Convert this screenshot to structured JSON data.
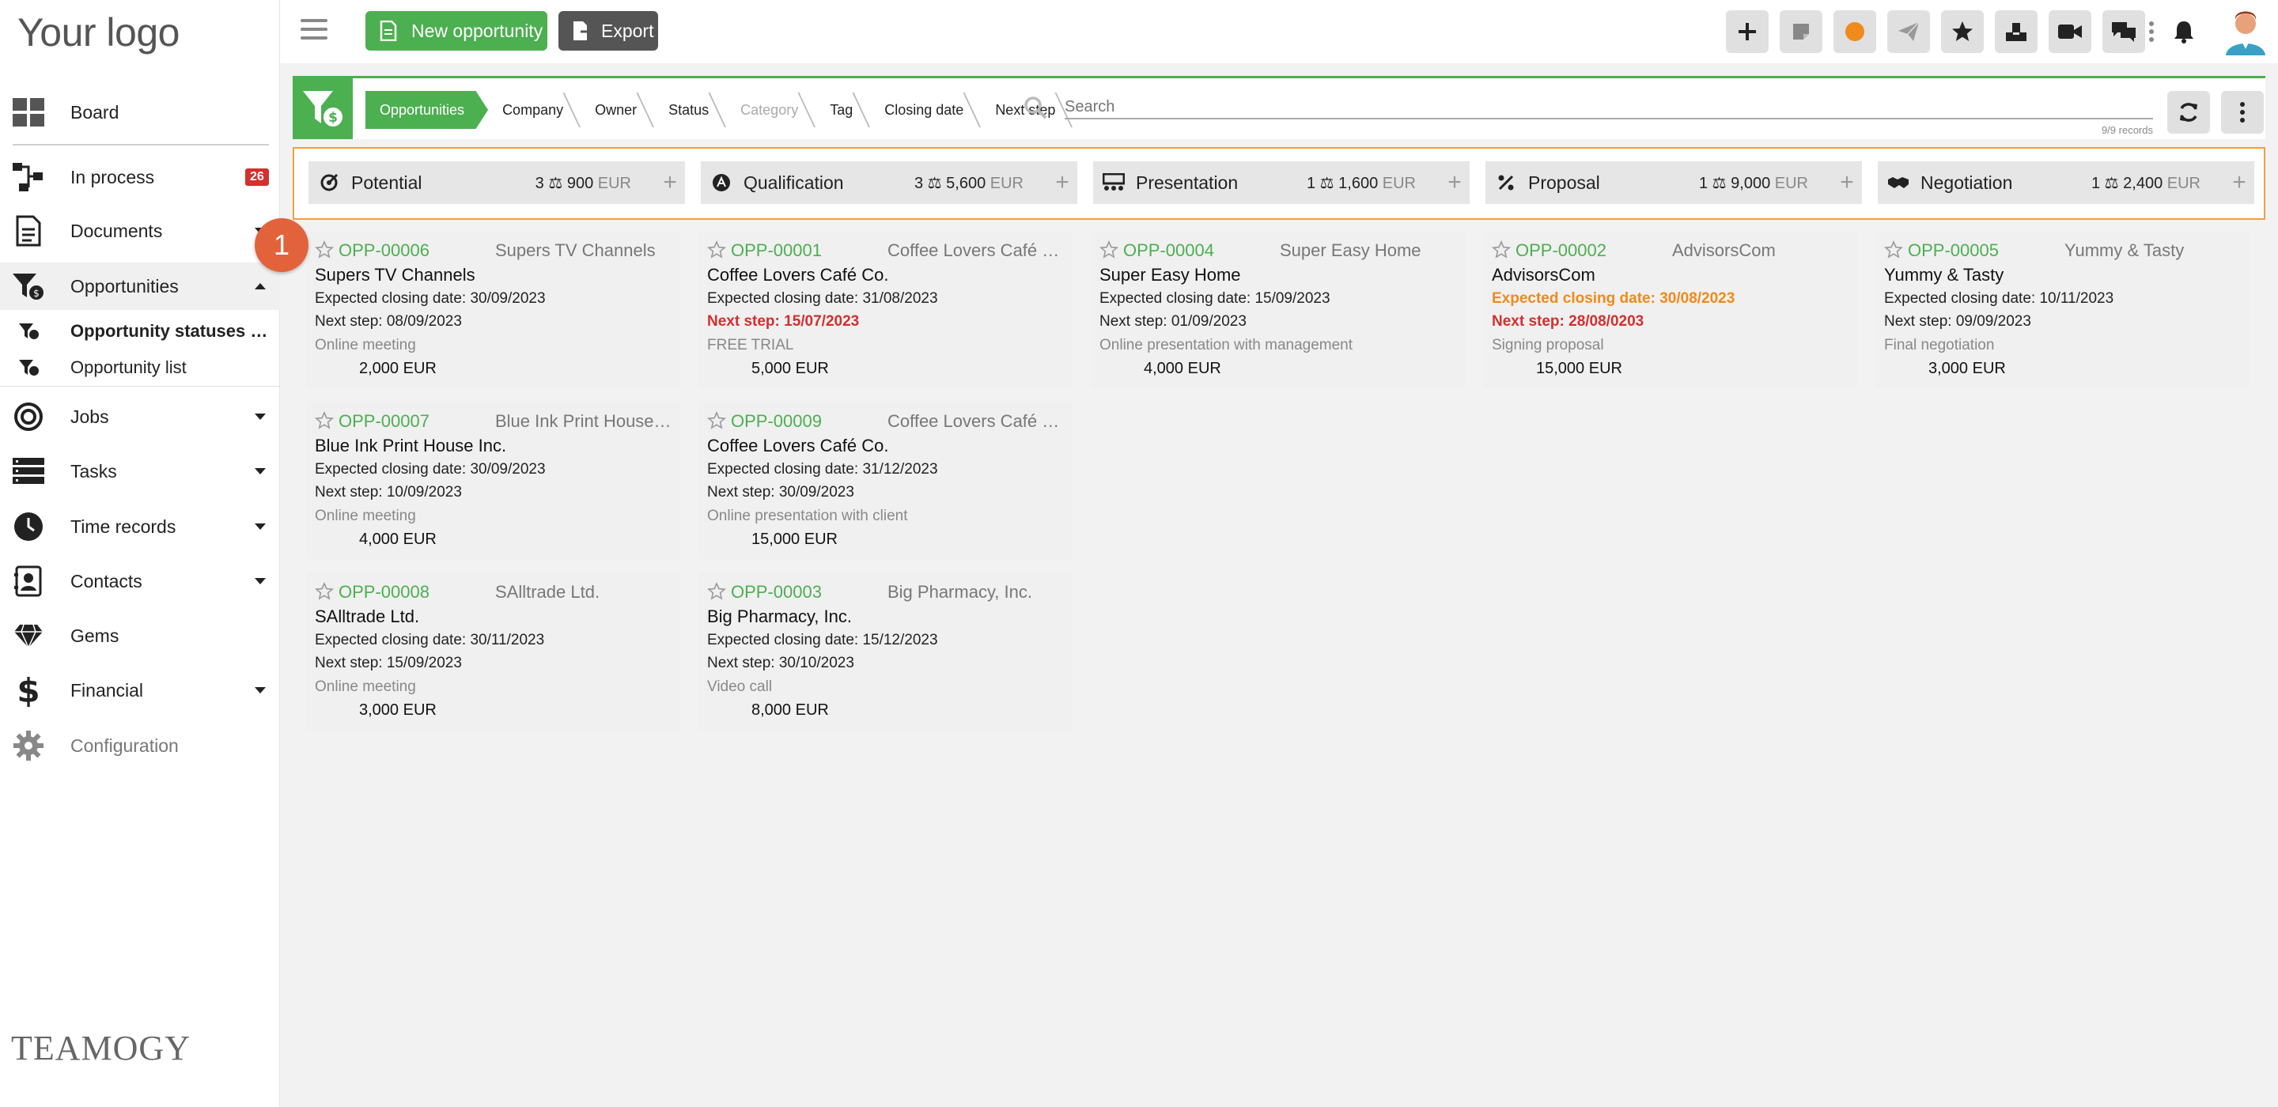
{
  "logo": "Your logo",
  "team_logo": "TEAMOGY",
  "sidebar": {
    "items": [
      {
        "label": "Board"
      },
      {
        "label": "In process",
        "badge": "26"
      },
      {
        "label": "Documents"
      },
      {
        "label": "Opportunities"
      },
      {
        "label": "Jobs"
      },
      {
        "label": "Tasks"
      },
      {
        "label": "Time records"
      },
      {
        "label": "Contacts"
      },
      {
        "label": "Gems"
      },
      {
        "label": "Financial"
      },
      {
        "label": "Configuration"
      }
    ],
    "subitems": [
      {
        "label": "Opportunity statuses (Kanban)"
      },
      {
        "label": "Opportunity list"
      }
    ]
  },
  "toolbar": {
    "new_label": "New opportunity",
    "export_label": "Export",
    "help_label": "?"
  },
  "filterbar": {
    "crumbs": [
      "Opportunities",
      "Company",
      "Owner",
      "Status",
      "Category",
      "Tag",
      "Closing date",
      "Next step"
    ],
    "search_placeholder": "Search",
    "records": "9/9 records"
  },
  "stages": [
    {
      "name": "Potential",
      "count": "3",
      "amount": "900",
      "currency": "EUR"
    },
    {
      "name": "Qualification",
      "count": "3",
      "amount": "5,600",
      "currency": "EUR"
    },
    {
      "name": "Presentation",
      "count": "1",
      "amount": "1,600",
      "currency": "EUR"
    },
    {
      "name": "Proposal",
      "count": "1",
      "amount": "9,000",
      "currency": "EUR"
    },
    {
      "name": "Negotiation",
      "count": "1",
      "amount": "2,400",
      "currency": "EUR"
    }
  ],
  "cards": [
    {
      "id": "OPP-00006",
      "company": "Supers TV Channels",
      "title": "Supers TV Channels",
      "closing": "Expected closing date: 30/09/2023",
      "next": "Next step: 08/09/2023",
      "note": "Online meeting",
      "amount": "2,000 EUR"
    },
    {
      "id": "OPP-00007",
      "company": "Blue Ink Print House Inc.",
      "title": "Blue Ink Print House Inc.",
      "closing": "Expected closing date: 30/09/2023",
      "next": "Next step: 10/09/2023",
      "note": "Online meeting",
      "amount": "4,000 EUR"
    },
    {
      "id": "OPP-00008",
      "company": "SAlltrade Ltd.",
      "title": "SAlltrade Ltd.",
      "closing": "Expected closing date: 30/11/2023",
      "next": "Next step: 15/09/2023",
      "note": "Online meeting",
      "amount": "3,000 EUR"
    },
    {
      "id": "OPP-00001",
      "company": "Coffee Lovers Café Co.",
      "title": "Coffee Lovers Café Co.",
      "closing": "Expected closing date: 31/08/2023",
      "next": "Next step: 15/07/2023",
      "note": "FREE TRIAL",
      "amount": "5,000 EUR"
    },
    {
      "id": "OPP-00009",
      "company": "Coffee Lovers Café Co.",
      "title": "Coffee Lovers Café Co.",
      "closing": "Expected closing date: 31/12/2023",
      "next": "Next step: 30/09/2023",
      "note": "Online presentation with client",
      "amount": "15,000 EUR"
    },
    {
      "id": "OPP-00003",
      "company": "Big Pharmacy, Inc.",
      "title": "Big Pharmacy, Inc.",
      "closing": "Expected closing date: 15/12/2023",
      "next": "Next step: 30/10/2023",
      "note": "Video call",
      "amount": "8,000 EUR"
    },
    {
      "id": "OPP-00004",
      "company": "Super Easy Home",
      "title": "Super Easy Home",
      "closing": "Expected closing date: 15/09/2023",
      "next": "Next step: 01/09/2023",
      "note": "Online presentation with management",
      "amount": "4,000 EUR"
    },
    {
      "id": "OPP-00002",
      "company": "AdvisorsCom",
      "title": "AdvisorsCom",
      "closing": "Expected closing date: 30/08/2023",
      "next": "Next step: 28/08/0203",
      "note": "Signing proposal",
      "amount": "15,000 EUR"
    },
    {
      "id": "OPP-00005",
      "company": "Yummy & Tasty",
      "title": "Yummy & Tasty",
      "closing": "Expected closing date: 10/11/2023",
      "next": "Next step: 09/09/2023",
      "note": "Final negotiation",
      "amount": "3,000 EUR"
    }
  ],
  "step_badge": "1",
  "colors": {
    "accent": "#4caf50",
    "overdue": "#d32f2f",
    "warning": "#f08a1a",
    "highlight_border": "#f0a040"
  }
}
